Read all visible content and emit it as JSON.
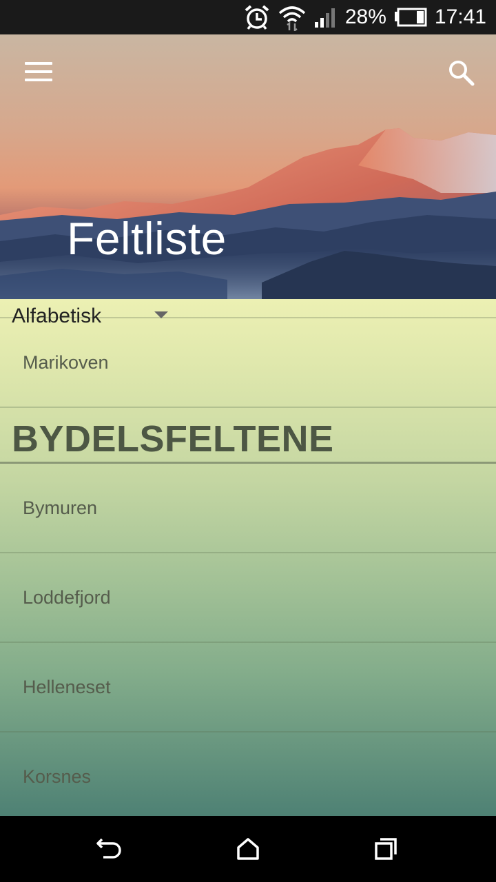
{
  "status_bar": {
    "battery_percent": "28%",
    "time": "17:41",
    "battery_level": 0.28,
    "icons": [
      "alarm-icon",
      "wifi-icon",
      "cellular-signal-icon",
      "battery-icon"
    ]
  },
  "header": {
    "title": "Feltliste",
    "menu_icon": "hamburger-menu-icon",
    "search_icon": "search-icon"
  },
  "sort": {
    "selected": "Alfabetisk",
    "icon": "dropdown-caret-icon"
  },
  "list": {
    "top_item": "Marikoven",
    "section_title": "BYDELSFELTENE",
    "items": [
      "Bymuren",
      "Loddefjord",
      "Helleneset",
      "Korsnes"
    ]
  },
  "nav_bar": {
    "icons": [
      "back-icon",
      "home-icon",
      "recents-icon"
    ]
  },
  "colors": {
    "status_bar_bg": "#1a1a1a",
    "list_gradient_top": "#ecf0b3",
    "list_gradient_bottom": "#4e8174",
    "section_title_color": "#4d5744",
    "item_text_color": "#555c4c"
  }
}
